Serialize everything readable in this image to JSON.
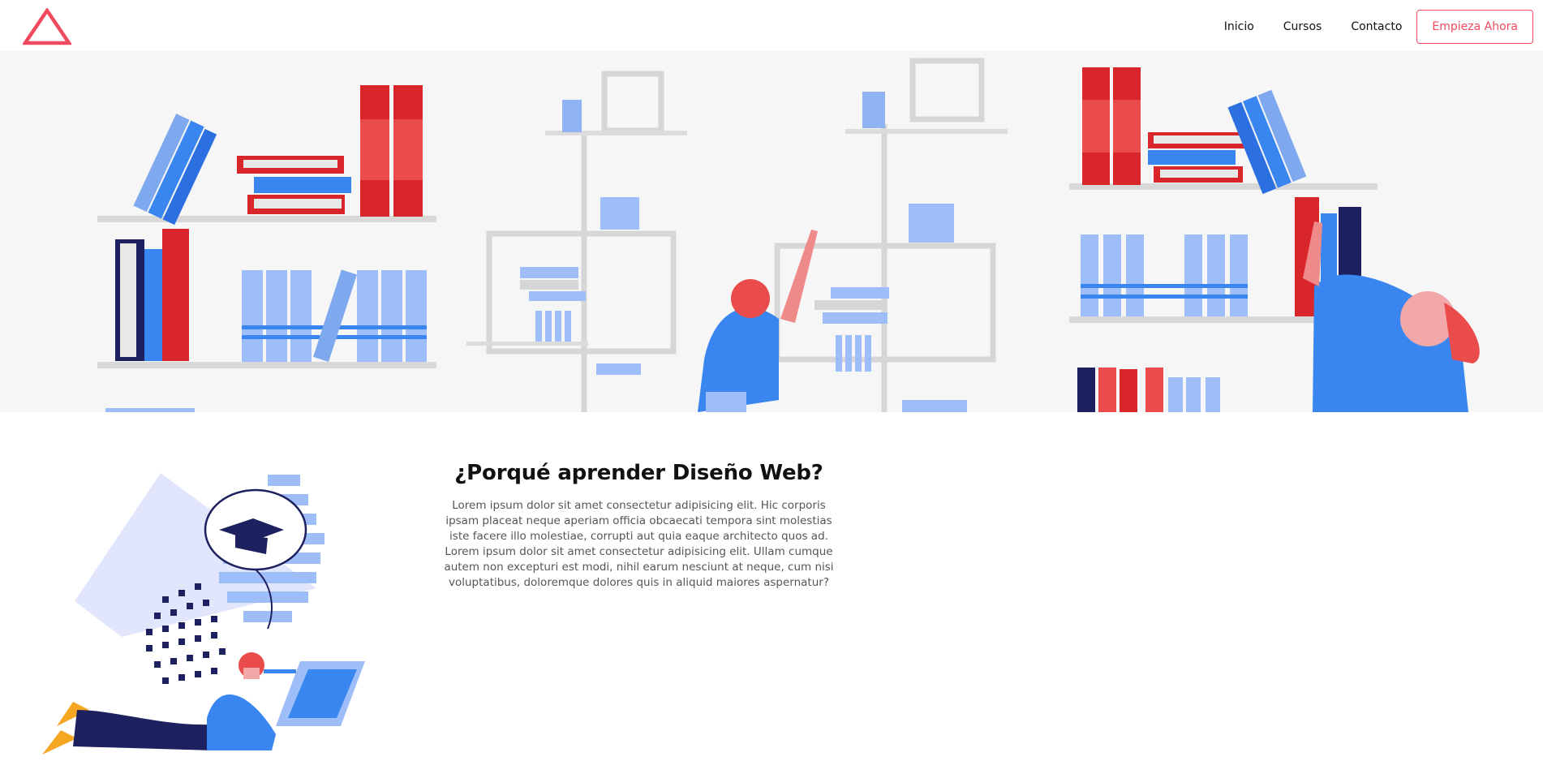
{
  "brand": {
    "logo_icon": "triangle-logo-icon",
    "accent_color": "#ef4a5e"
  },
  "nav": {
    "links": [
      "Inicio",
      "Cursos",
      "Contacto"
    ],
    "cta": "Empieza Ahora"
  },
  "hero": {
    "illustration": "library-bookshelves-illustration"
  },
  "section": {
    "illustration": "student-laptop-graduation-illustration",
    "title": "¿Porqué aprender Diseño Web?",
    "paragraph": "Lorem ipsum dolor sit amet consectetur adipisicing elit. Hic corporis ipsam placeat neque aperiam officia obcaecati tempora sint molestias iste facere illo molestiae, corrupti aut quia eaque architecto quos ad. Lorem ipsum dolor sit amet consectetur adipisicing elit. Ullam cumque autem non excepturi est modi, nihil earum nesciunt at neque, cum nisi voluptatibus, doloremque dolores quis in aliquid maiores aspernatur?"
  }
}
